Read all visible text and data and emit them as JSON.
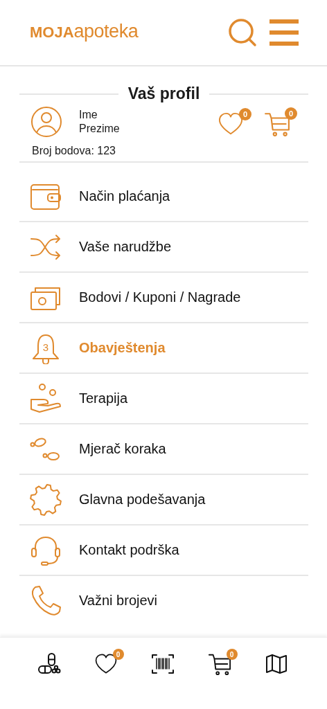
{
  "header": {
    "logo": "**MOJA**apoteka"
  },
  "profile": {
    "title": "Vaš profil",
    "first_name": "Ime",
    "last_name": "Prezime",
    "points": "Broj bodova: 123",
    "favorites_count": "0",
    "cart_count": "0"
  },
  "menu": [
    {
      "label": "Način plaćanja",
      "selected": false
    },
    {
      "label": "Vaše narudžbe",
      "selected": false
    },
    {
      "label": "Bodovi / Kuponi / Nagrade",
      "selected": false
    },
    {
      "label": "Obavještenja",
      "selected": true,
      "badge": "3"
    },
    {
      "label": "Terapija",
      "selected": false
    },
    {
      "label": "Mjerač koraka",
      "selected": false
    },
    {
      "label": "Glavna podešavanja",
      "selected": false
    },
    {
      "label": "Kontakt podrška",
      "selected": false
    },
    {
      "label": "Važni brojevi",
      "selected": false
    }
  ],
  "bottom_nav": [
    {
      "kind": "pills"
    },
    {
      "kind": "favorites",
      "badge": "0"
    },
    {
      "kind": "scan"
    },
    {
      "kind": "cart",
      "badge": "0"
    },
    {
      "kind": "map"
    }
  ]
}
